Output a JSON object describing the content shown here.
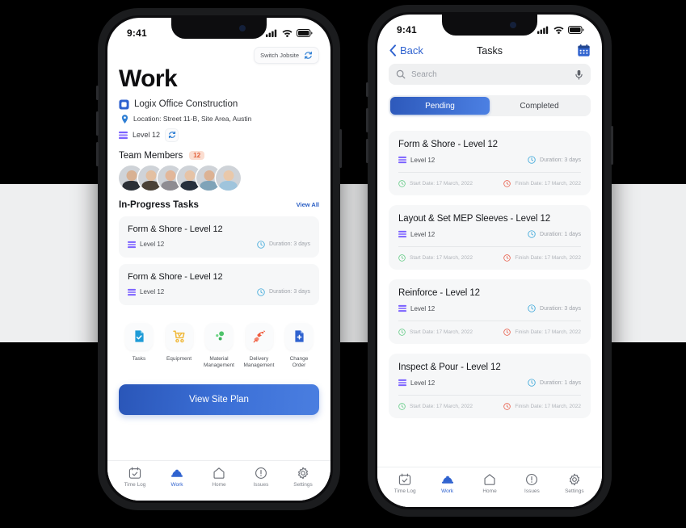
{
  "theme": {
    "accent_blue": "#2f62cf",
    "cta_gradient_from": "#2a56b8",
    "cta_gradient_to": "#4a7ee0",
    "level_purple": "#7b61ff",
    "badge_bg": "#fbddd0",
    "badge_text": "#e2603a",
    "start_green": "#5bc97f",
    "finish_red": "#e8543f",
    "duration_blue": "#37a6d9",
    "card_bg": "#f6f7f8",
    "screen_bg": "#ffffff",
    "page_bg": "#000000",
    "band_bg": "#eeeff0"
  },
  "status_bar": {
    "time": "9:41",
    "icons": [
      "cellular-signal-icon",
      "wifi-icon",
      "battery-icon"
    ]
  },
  "left_phone": {
    "switch_jobsite": {
      "label": "Switch Jobsite",
      "icon": "sync-icon"
    },
    "page_title": "Work",
    "company": {
      "name": "Logix Office Construction",
      "icon": "project-square-icon"
    },
    "location": {
      "text": "Location: Street 11-B, Site Area, Austin",
      "icon": "map-pin-icon"
    },
    "level": {
      "text": "Level 12",
      "icon": "layers-icon",
      "sync_icon": "sync-icon"
    },
    "team": {
      "title": "Team Members",
      "count": "12",
      "avatars": [
        {
          "name": "team-avatar-1",
          "skin": "#d8b193",
          "hair": "#3a2a20",
          "shirt": "#2b2f36"
        },
        {
          "name": "team-avatar-2",
          "skin": "#e3c0a2",
          "hair": "#c9b07c",
          "shirt": "#4a4137"
        },
        {
          "name": "team-avatar-3",
          "skin": "#e2b79a",
          "hair": "#5d3a2c",
          "shirt": "#8e8c92"
        },
        {
          "name": "team-avatar-4",
          "skin": "#e6c3a6",
          "hair": "#7a5c42",
          "shirt": "#27303d"
        },
        {
          "name": "team-avatar-5",
          "skin": "#dcb294",
          "hair": "#2f2a26",
          "shirt": "#7fa3b8"
        },
        {
          "name": "team-avatar-6",
          "skin": "#e9c8aa",
          "hair": "#8a6b4a",
          "shirt": "#9fc4dc"
        }
      ]
    },
    "in_progress": {
      "title": "In-Progress Tasks",
      "view_all": "View All",
      "tasks": [
        {
          "title": "Form & Shore - Level 12",
          "level": "Level 12",
          "duration": "Duration: 3 days"
        },
        {
          "title": "Form & Shore - Level 12",
          "level": "Level 12",
          "duration": "Duration: 3 days"
        }
      ]
    },
    "apps": [
      {
        "label": "Tasks",
        "icon": "document-check-icon",
        "color": "#1e9bd7"
      },
      {
        "label": "Equipment",
        "icon": "shopping-cart-icon",
        "color": "#f0b93b"
      },
      {
        "label": "Material\nManagement",
        "label_line1": "Material",
        "label_line2": "Management",
        "icon": "molecule-dots-icon",
        "color": "#4fc36b"
      },
      {
        "label": "Delivery\nManagement",
        "label_line1": "Delivery",
        "label_line2": "Management",
        "icon": "rocket-icon",
        "color": "#ef5a3c"
      },
      {
        "label": "Change\nOrder",
        "label_line1": "Change",
        "label_line2": "Order",
        "icon": "document-plus-icon",
        "color": "#2f62cf"
      }
    ],
    "cta_button": "View Site Plan"
  },
  "right_phone": {
    "nav": {
      "back_label": "Back",
      "back_icon": "chevron-left-icon",
      "title": "Tasks",
      "calendar_icon": "calendar-icon"
    },
    "search": {
      "placeholder": "Search",
      "search_icon": "search-icon",
      "mic_icon": "microphone-icon"
    },
    "segments": [
      {
        "label": "Pending",
        "selected": true
      },
      {
        "label": "Completed",
        "selected": false
      }
    ],
    "tasks": [
      {
        "title": "Form & Shore - Level 12",
        "level": "Level 12",
        "duration": "Duration: 3 days",
        "start_date": "Start Date: 17 March, 2022",
        "finish_date": "Finish Date: 17 March, 2022"
      },
      {
        "title": "Layout & Set MEP Sleeves - Level 12",
        "level": "Level 12",
        "duration": "Duration: 1 days",
        "start_date": "Start Date: 17 March, 2022",
        "finish_date": "Finish Date: 17 March, 2022"
      },
      {
        "title": "Reinforce - Level 12",
        "level": "Level 12",
        "duration": "Duration: 3 days",
        "start_date": "Start Date: 17 March, 2022",
        "finish_date": "Finish Date: 17 March, 2022"
      },
      {
        "title": "Inspect & Pour - Level 12",
        "level": "Level 12",
        "duration": "Duration: 1 days",
        "start_date": "Start Date: 17 March, 2022",
        "finish_date": "Finish Date: 17 March, 2022"
      }
    ]
  },
  "tab_bar": {
    "items": [
      {
        "label": "Time Log",
        "icon": "calendar-check-icon",
        "active": false
      },
      {
        "label": "Work",
        "icon": "hard-hat-icon",
        "active": true
      },
      {
        "label": "Home",
        "icon": "home-icon",
        "active": false
      },
      {
        "label": "Issues",
        "icon": "alert-circle-icon",
        "active": false
      },
      {
        "label": "Settings",
        "icon": "gear-icon",
        "active": false
      }
    ]
  }
}
